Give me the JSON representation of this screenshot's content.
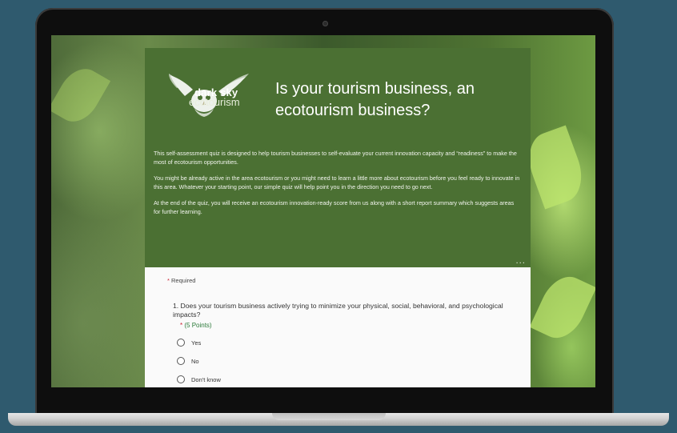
{
  "hero": {
    "logo_line1": "dark sky",
    "logo_line2": "ecotourism",
    "title": "Is your tourism business, an ecotourism business?",
    "paragraphs": [
      "This self-assessment quiz is designed to help tourism businesses to self-evaluate your current innovation capacity and “readiness” to make the most of ecotourism opportunities.",
      "You might be already active in the area ecotourism or you might need to learn a little more about ecotourism before you feel ready to innovate in this area. Whatever your starting point, our simple quiz will help point you in the direction you need to go next.",
      "At the end of the quiz, you will receive an ecotourism innovation-ready score from us along with a short report summary which suggests areas for further learning."
    ],
    "more_label": "..."
  },
  "form": {
    "required_star": "*",
    "required_label": "Required",
    "question_text": "1. Does your tourism business actively trying to minimize your physical, social, behavioral, and psychological impacts?",
    "points_star": "*",
    "points_label": "(5 Points)",
    "options": [
      "Yes",
      "No",
      "Don't know"
    ]
  },
  "colors": {
    "hero_bg": "#4b7033",
    "accent_green": "#2c7a3a",
    "required_red": "#cc2233"
  },
  "icons": {
    "logo": "owl-icon",
    "more": "more-dots-icon",
    "radio": "radio-circle-icon"
  }
}
